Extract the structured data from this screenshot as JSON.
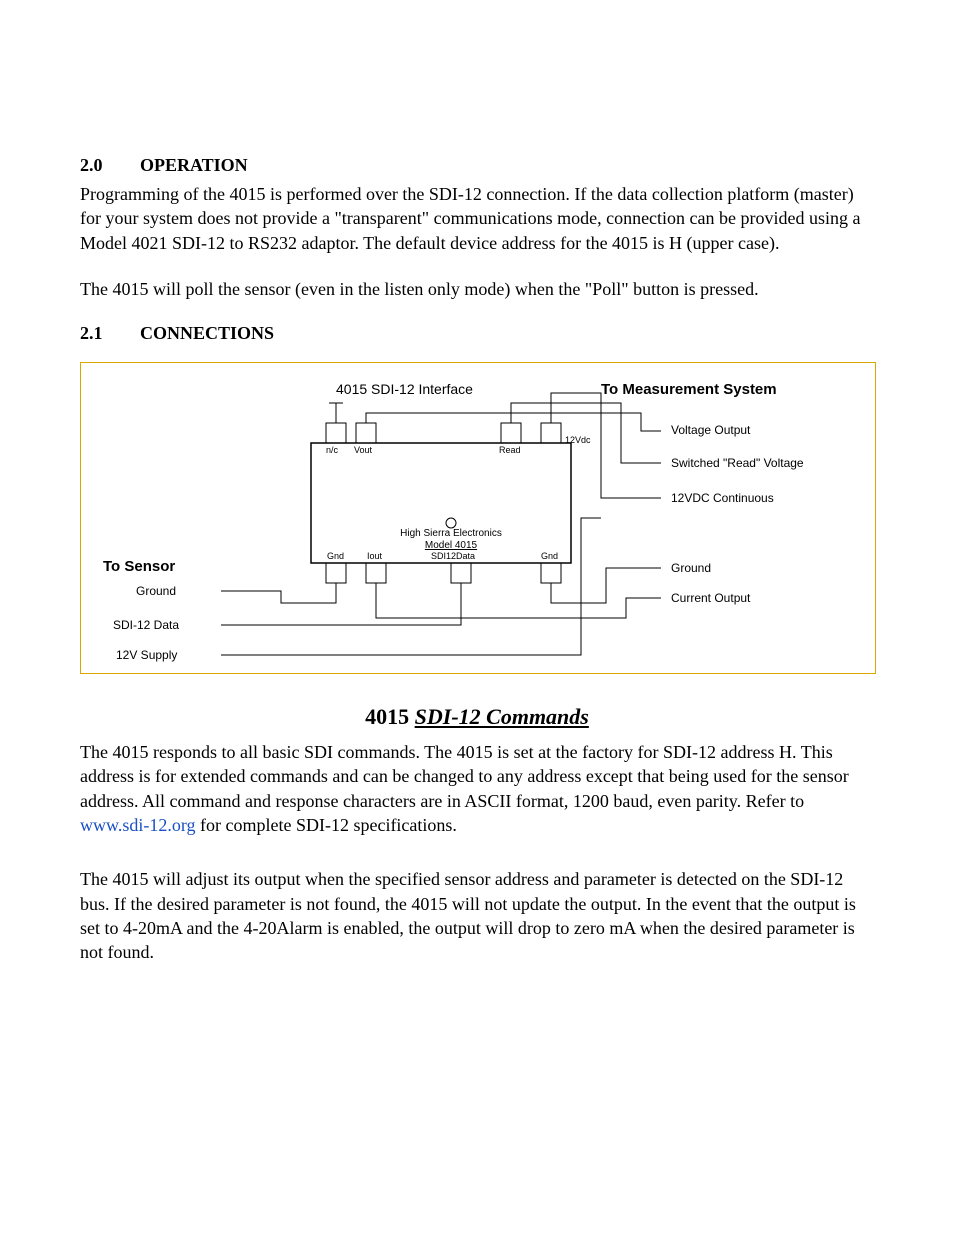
{
  "sec20": {
    "num": "2.0",
    "title": "OPERATION",
    "p1": "Programming of the 4015 is performed over the SDI-12 connection.  If the data collection platform (master) for your system does not provide a \"transparent\" communications mode, connection can  be provided using a Model 4021 SDI-12 to RS232 adaptor.  The default device address for the 4015 is H (upper case).",
    "p2": "The 4015 will poll the sensor (even in the listen only mode) when the \"Poll\" button is pressed."
  },
  "sec21": {
    "num": "2.1",
    "title": "CONNECTIONS"
  },
  "diagram": {
    "top_left_title": "4015 SDI-12 Interface",
    "top_right_title": "To Measurement System",
    "right_labels": {
      "voltage_output": "Voltage Output",
      "switched_read_voltage": "Switched \"Read\" Voltage",
      "twelve_vdc": "12VDC Continuous",
      "ground": "Ground",
      "current_output": "Current Output"
    },
    "left_title": "To Sensor",
    "left_labels": {
      "ground": "Ground",
      "sdi12_data": "SDI-12 Data",
      "twelve_v_supply": "12V Supply"
    },
    "device_line1": "High Sierra Electronics",
    "device_line2": "Model 4015",
    "terminals": {
      "nc": "n/c",
      "vout": "Vout",
      "read": "Read",
      "twelve_vdc": "12Vdc",
      "gnd_left": "Gnd",
      "iout": "Iout",
      "sdi12data": "SDI12Data",
      "gnd_right": "Gnd"
    },
    "poll_symbol": "○"
  },
  "commands": {
    "title_bold": "4015",
    "title_italic": "SDI-12 Commands",
    "p1_a": "The 4015 responds to all basic SDI commands.   The 4015 is set at the factory for SDI-12 address H.  This address is for extended commands and can be changed to any address except that being used for the sensor address.  All command and response characters are in ASCII format, 1200 baud, even parity",
    "p1_b": ".  Refer to ",
    "link_text": "www.sdi-12.org",
    "p1_c": " for complete SDI-12 specifications.",
    "p2": "The 4015 will adjust its output when the specified sensor address and parameter is detected on the SDI-12 bus.  If the desired parameter is not found, the 4015 will not update the output.  In the event that the output is set to 4-20mA and the 4-20Alarm is enabled, the output will drop to zero mA when the desired parameter is not found."
  }
}
